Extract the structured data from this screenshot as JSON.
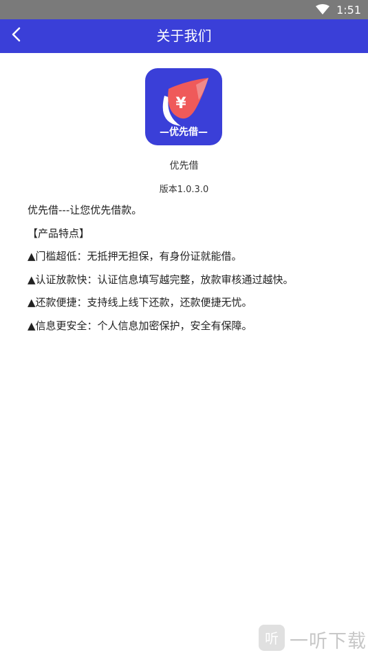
{
  "status_bar": {
    "time": "1:51"
  },
  "app_bar": {
    "title": "关于我们"
  },
  "logo": {
    "text": "—优先借—"
  },
  "app_info": {
    "name": "优先借",
    "version": "版本1.0.3.0"
  },
  "content": {
    "intro": "优先借---让您优先借款。",
    "section_title": "【产品特点】",
    "features": [
      "▲门槛超低：无抵押无担保，有身份证就能借。",
      "▲认证放款快：认证信息填写越完整，放款审核通过越快。",
      "▲还款便捷：支持线上线下还款，还款便捷无忧。",
      "▲信息更安全：个人信息加密保护，安全有保障。"
    ]
  },
  "watermark": {
    "text": "一听下载"
  },
  "colors": {
    "primary": "#3a3fd8",
    "status_bar": "#7a7a7a",
    "logo_accent": "#ef5a5a"
  },
  "icons": {
    "back": "chevron-left-icon",
    "wifi": "wifi-icon",
    "battery": "battery-icon"
  }
}
